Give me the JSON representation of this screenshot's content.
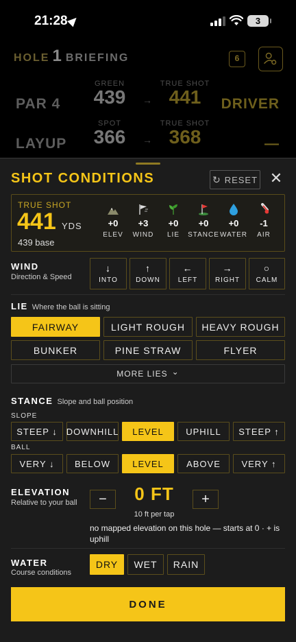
{
  "status": {
    "time": "21:28",
    "battery": "3"
  },
  "briefing": {
    "hole_word": "HOLE",
    "hole_number": "1",
    "briefing_word": "BRIEFING",
    "hole_badge": "6",
    "rows": [
      {
        "label": "PAR 4",
        "c1_small": "GREEN",
        "c1_value": "439",
        "c2_small": "TRUE SHOT",
        "c2_value": "441",
        "right": "DRIVER"
      },
      {
        "label": "LAYUP",
        "c1_small": "SPOT",
        "c1_value": "366",
        "c2_small": "TRUE SHOT",
        "c2_value": "368",
        "right": "—"
      }
    ]
  },
  "sheet": {
    "title": "SHOT CONDITIONS",
    "reset_label": "RESET",
    "close_glyph": "✕"
  },
  "true_shot": {
    "label": "TRUE SHOT",
    "value": "441",
    "unit": "YDS",
    "base": "439 base",
    "adjustments": [
      {
        "icon": "mountain-icon",
        "value": "+0",
        "name": "ELEV"
      },
      {
        "icon": "wind-flag-icon",
        "value": "+3",
        "name": "WIND"
      },
      {
        "icon": "leaf-icon",
        "value": "+0",
        "name": "LIE"
      },
      {
        "icon": "golf-flag-icon",
        "value": "+0",
        "name": "STANCE"
      },
      {
        "icon": "water-drop-icon",
        "value": "+0",
        "name": "WATER"
      },
      {
        "icon": "thermometer-icon",
        "value": "-1",
        "name": "AIR"
      }
    ]
  },
  "wind": {
    "title": "WIND",
    "subtitle": "Direction & Speed",
    "options": [
      {
        "glyph": "↓",
        "label": "INTO"
      },
      {
        "glyph": "↑",
        "label": "DOWN"
      },
      {
        "glyph": "←",
        "label": "LEFT"
      },
      {
        "glyph": "→",
        "label": "RIGHT"
      },
      {
        "glyph": "○",
        "label": "CALM"
      }
    ]
  },
  "lie": {
    "title": "LIE",
    "subtitle": "Where the ball is sitting",
    "options": [
      "FAIRWAY",
      "LIGHT ROUGH",
      "HEAVY ROUGH",
      "BUNKER",
      "PINE STRAW",
      "FLYER"
    ],
    "selected": "FAIRWAY",
    "more_label": "MORE LIES",
    "more_glyph": "⌄"
  },
  "stance": {
    "title": "STANCE",
    "subtitle": "Slope and ball position",
    "slope_label": "SLOPE",
    "slope_options": [
      "STEEP ↓",
      "DOWNHILL",
      "LEVEL",
      "UPHILL",
      "STEEP ↑"
    ],
    "slope_selected": "LEVEL",
    "ball_label": "BALL",
    "ball_options": [
      "VERY ↓",
      "BELOW",
      "LEVEL",
      "ABOVE",
      "VERY ↑"
    ],
    "ball_selected": "LEVEL"
  },
  "elevation": {
    "title": "ELEVATION",
    "subtitle": "Relative to your ball",
    "minus": "−",
    "plus": "+",
    "value": "0 FT",
    "per_tap": "10 ft per tap",
    "note": "no mapped elevation on this hole — starts at 0 · + is uphill"
  },
  "water": {
    "title": "WATER",
    "subtitle": "Course conditions",
    "options": [
      "DRY",
      "WET",
      "RAIN"
    ],
    "selected": "DRY"
  },
  "done_label": "DONE",
  "colors": {
    "accent": "#f5c518",
    "background": "#1c1c1c",
    "border": "#5b4e1c"
  }
}
